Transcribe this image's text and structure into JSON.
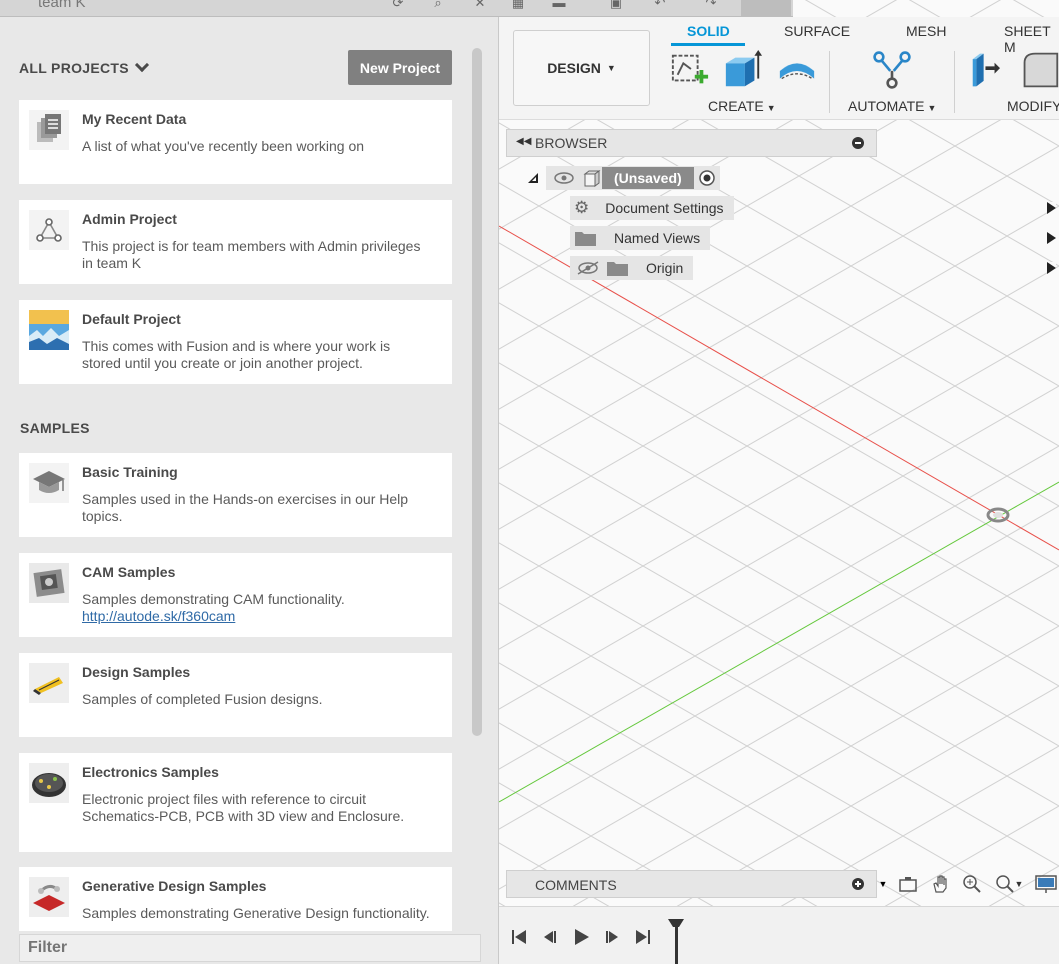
{
  "window": {
    "title": "team K"
  },
  "projects": {
    "header": "ALL PROJECTS",
    "new_button": "New Project",
    "items": [
      {
        "title": "My Recent Data",
        "description": "A list of what you've recently been working on",
        "icon": "documents-icon"
      },
      {
        "title": "Admin Project",
        "description": "This project is for team members with Admin privileges in team K",
        "icon": "admin-share-icon"
      },
      {
        "title": "Default Project",
        "description": "This comes with Fusion and is where your work is stored until you create or join another project.",
        "icon": "default-project-thumbnail"
      }
    ]
  },
  "samples": {
    "header": "SAMPLES",
    "items": [
      {
        "title": "Basic Training",
        "description": "Samples used in the Hands-on exercises in our Help topics.",
        "icon": "graduation-cap-icon"
      },
      {
        "title": "CAM Samples",
        "description": "Samples demonstrating CAM functionality.",
        "link": "http://autode.sk/f360cam",
        "icon": "cam-thumbnail"
      },
      {
        "title": "Design Samples",
        "description": "Samples of completed Fusion designs.",
        "icon": "design-thumbnail"
      },
      {
        "title": "Electronics Samples",
        "description": "Electronic project files with reference to circuit Schematics-PCB, PCB with 3D view and Enclosure.",
        "icon": "electronics-thumbnail"
      },
      {
        "title": "Generative Design Samples",
        "description": "Samples demonstrating Generative Design functionality.",
        "icon": "generative-thumbnail"
      }
    ]
  },
  "filter": {
    "placeholder": "Filter"
  },
  "toolbar": {
    "workspace": "DESIGN",
    "tabs": [
      "SOLID",
      "SURFACE",
      "MESH",
      "SHEET M"
    ],
    "active_tab": "SOLID",
    "groups": [
      "CREATE",
      "AUTOMATE",
      "MODIFY"
    ]
  },
  "browser": {
    "label": "BROWSER",
    "root": "(Unsaved)",
    "nodes": [
      "Document Settings",
      "Named Views",
      "Origin"
    ]
  },
  "comments": {
    "label": "COMMENTS"
  },
  "colors": {
    "accent": "#0696d7",
    "x_axis": "#e8504a",
    "y_axis": "#64c83c"
  }
}
